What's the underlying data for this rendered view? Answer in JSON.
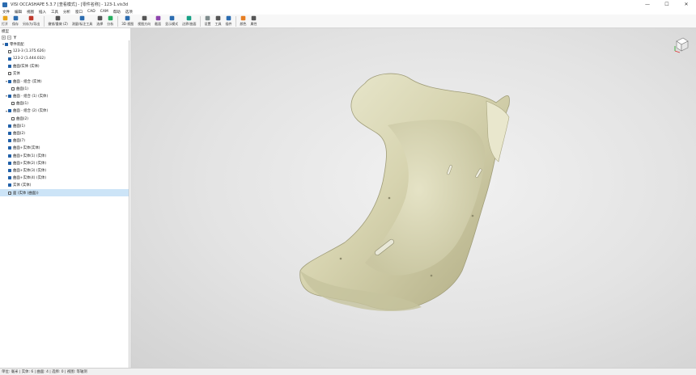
{
  "window": {
    "title": "VISI OCCASHAPE 5.3.7 [查看模式] - [零件名称] - 123-1.vis3d",
    "min_label": "—",
    "max_label": "☐",
    "close_label": "✕"
  },
  "menu": [
    "文件",
    "编辑",
    "视图",
    "插入",
    "工具",
    "分析",
    "窗口",
    "CAD",
    "CAM",
    "帮助",
    "选项"
  ],
  "toolbar": [
    {
      "label": "打开",
      "icon": "folder-icon"
    },
    {
      "label": "保存",
      "icon": "save-icon"
    },
    {
      "label": "另存为/导出",
      "icon": "export-icon"
    },
    {
      "label": "撤销/重做 (Z)",
      "icon": "undo-icon"
    },
    {
      "label": "测量/标注工具",
      "icon": "measure-icon"
    },
    {
      "label": "选择",
      "icon": "select-icon"
    },
    {
      "label": "分析",
      "icon": "analyze-icon"
    },
    {
      "label": "3D 视图",
      "icon": "cube-icon"
    },
    {
      "label": "视图方向",
      "icon": "view-icon"
    },
    {
      "label": "截面",
      "icon": "section-icon"
    },
    {
      "label": "显示模式",
      "icon": "display-icon"
    },
    {
      "label": "边界/曲面",
      "icon": "surface-icon"
    },
    {
      "label": "设置",
      "icon": "gear-icon"
    },
    {
      "label": "工具",
      "icon": "tool-icon"
    },
    {
      "label": "插件",
      "icon": "plugin-icon"
    },
    {
      "label": "颜色",
      "icon": "color-icon"
    },
    {
      "label": "属性",
      "icon": "properties-icon"
    }
  ],
  "panel": {
    "title": "模型"
  },
  "tree": [
    {
      "label": "零件装配",
      "indent": 0,
      "expanded": true,
      "checked": true
    },
    {
      "label": "123-3 (1.375.626)",
      "indent": 1,
      "expanded": false,
      "checked": false
    },
    {
      "label": "123-2 (1.444.032)",
      "indent": 1,
      "expanded": false,
      "checked": true
    },
    {
      "label": "曲面/实体 (实体)",
      "indent": 1,
      "expanded": false,
      "checked": true
    },
    {
      "label": "实体",
      "indent": 1,
      "expanded": false,
      "checked": false
    },
    {
      "label": "曲面 - 组合 (实体)",
      "indent": 1,
      "expanded": true,
      "checked": true
    },
    {
      "label": "曲面(1)",
      "indent": 2,
      "expanded": false,
      "checked": false
    },
    {
      "label": "曲面 - 组合 (1) (实体)",
      "indent": 1,
      "expanded": true,
      "checked": true
    },
    {
      "label": "曲面(1)",
      "indent": 2,
      "expanded": false,
      "checked": false
    },
    {
      "label": "曲面 - 组合 (2) (实体)",
      "indent": 1,
      "expanded": true,
      "checked": true
    },
    {
      "label": "曲面(2)",
      "indent": 2,
      "expanded": false,
      "checked": false
    },
    {
      "label": "曲面(1)",
      "indent": 1,
      "expanded": false,
      "checked": true
    },
    {
      "label": "曲面(2)",
      "indent": 1,
      "expanded": false,
      "checked": true
    },
    {
      "label": "曲面(7)",
      "indent": 1,
      "expanded": false,
      "checked": true
    },
    {
      "label": "曲面+实体(实体)",
      "indent": 1,
      "expanded": false,
      "checked": true
    },
    {
      "label": "曲面+实体(1) (实体)",
      "indent": 1,
      "expanded": false,
      "checked": true
    },
    {
      "label": "曲面+实体(2) (实体)",
      "indent": 1,
      "expanded": false,
      "checked": true
    },
    {
      "label": "曲面+实体(3) (实体)",
      "indent": 1,
      "expanded": false,
      "checked": true
    },
    {
      "label": "曲面+实体(4) (实体)",
      "indent": 1,
      "expanded": false,
      "checked": true
    },
    {
      "label": "实体 (实体)",
      "indent": 1,
      "expanded": false,
      "checked": true
    },
    {
      "label": "面 (实体 (曲面))",
      "indent": 1,
      "expanded": false,
      "checked": false,
      "selected": true
    }
  ],
  "status": "单位: 毫米 | 实体: 6 | 曲面: 4 | 选择: 0 | 视图: 等轴测",
  "colors": {
    "part": "#d9d6b4",
    "selection": "#cce4f7",
    "accent": "#1f5fa8"
  }
}
